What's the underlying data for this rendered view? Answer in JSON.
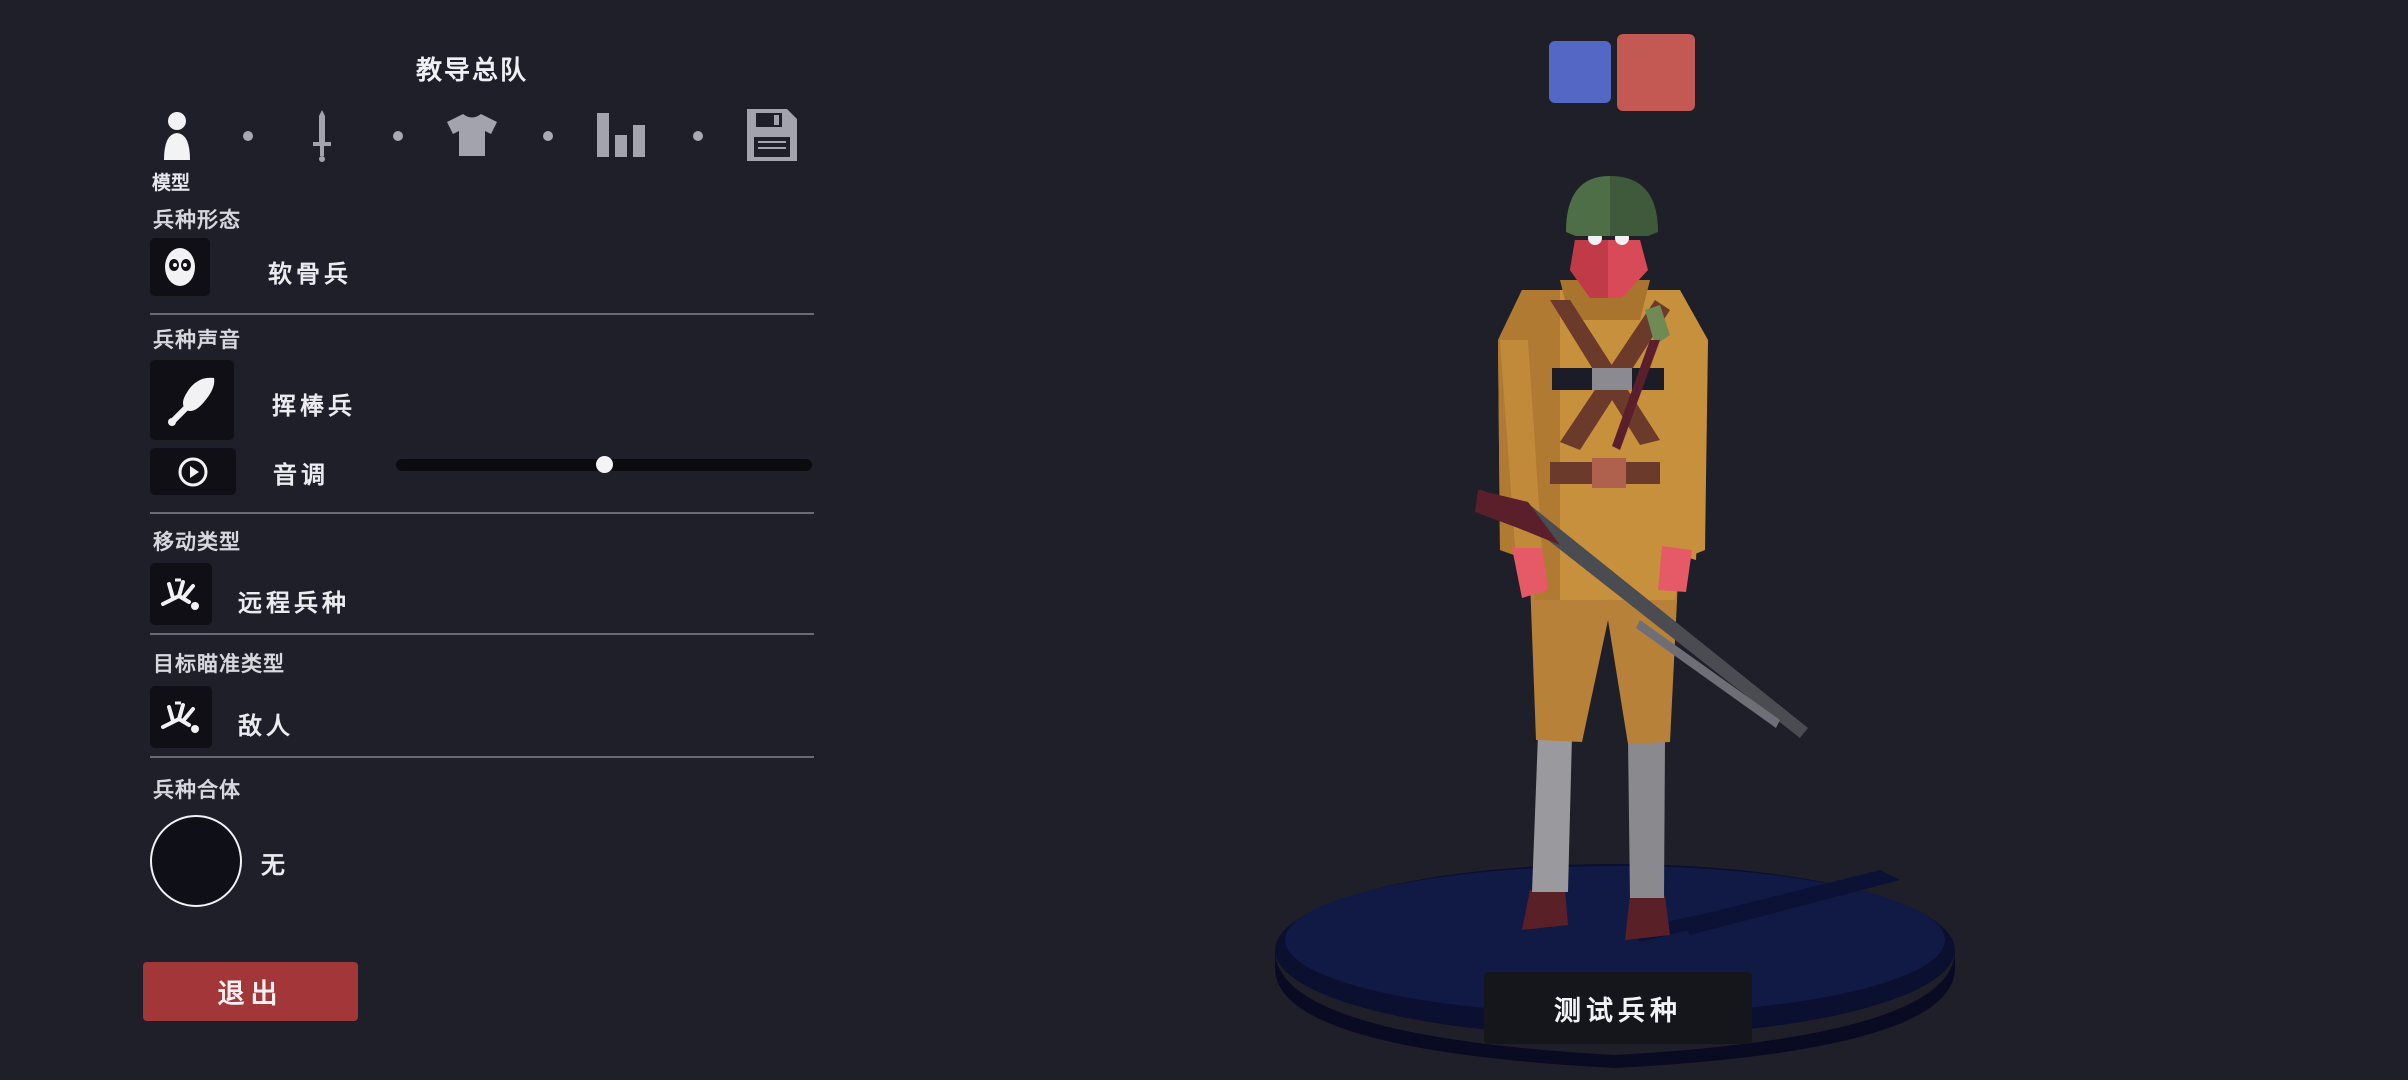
{
  "header": {
    "unit_name": "教导总队"
  },
  "tabs": [
    {
      "icon": "person-icon",
      "active": true
    },
    {
      "icon": "sword-icon",
      "active": false
    },
    {
      "icon": "shirt-icon",
      "active": false
    },
    {
      "icon": "stats-icon",
      "active": false
    },
    {
      "icon": "save-icon",
      "active": false
    }
  ],
  "active_tab_label": "模型",
  "sections": {
    "form": {
      "label": "兵种形态",
      "value": "软骨兵",
      "icon": "face-mask-icon"
    },
    "voice": {
      "label": "兵种声音",
      "value": "挥棒兵",
      "icon": "drumstick-icon",
      "pitch_label": "音调",
      "pitch_value": 0.5
    },
    "movement": {
      "label": "移动类型",
      "value": "远程兵种",
      "icon": "fallen-unit-icon"
    },
    "targeting": {
      "label": "目标瞄准类型",
      "value": "敌人",
      "icon": "fallen-unit-icon"
    },
    "merge": {
      "label": "兵种合体",
      "value": "无"
    }
  },
  "buttons": {
    "exit": "退出",
    "test_unit": "测试兵种"
  },
  "team_colors": {
    "blue": "#5467c4",
    "red": "#c45853",
    "selected": "red"
  },
  "accent": {
    "exit_button": "#a23639"
  }
}
